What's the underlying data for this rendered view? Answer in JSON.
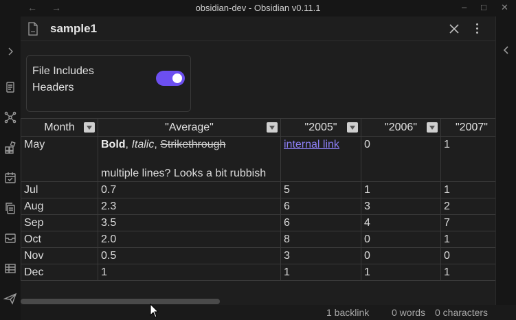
{
  "window": {
    "title": "obsidian-dev - Obsidian v0.11.1"
  },
  "file": {
    "title": "sample1"
  },
  "options": {
    "headers_label": "File Includes Headers",
    "headers_enabled": true
  },
  "table": {
    "columns": [
      "Month",
      "\"Average\"",
      "\"2005\"",
      "\"2006\"",
      "\"2007\""
    ],
    "first_row": {
      "month": "May",
      "avg_bold": "Bold",
      "avg_sep1": ", ",
      "avg_italic": "Italic",
      "avg_sep2": ", ",
      "avg_strike": "Strikethrough",
      "avg_second_line": "multiple lines? Looks a bit rubbish",
      "y2005_link": "internal link",
      "y2006": "0",
      "y2007": "1"
    },
    "rows": [
      {
        "month": "Jul",
        "avg": "0.7",
        "y2005": "5",
        "y2006": "1",
        "y2007": "1"
      },
      {
        "month": "Aug",
        "avg": "2.3",
        "y2005": "6",
        "y2006": "3",
        "y2007": "2"
      },
      {
        "month": "Sep",
        "avg": "3.5",
        "y2005": "6",
        "y2006": "4",
        "y2007": "7"
      },
      {
        "month": "Oct",
        "avg": "2.0",
        "y2005": "8",
        "y2006": "0",
        "y2007": "1"
      },
      {
        "month": "Nov",
        "avg": "0.5",
        "y2005": "3",
        "y2006": "0",
        "y2007": "0"
      },
      {
        "month": "Dec",
        "avg": "1",
        "y2005": "1",
        "y2006": "1",
        "y2007": "1"
      }
    ]
  },
  "status": {
    "backlinks": "1 backlink",
    "words": "0 words",
    "characters": "0 characters"
  },
  "colors": {
    "accent": "#6c4ff0",
    "link": "#8c7ff5",
    "background": "#1e1e1e"
  },
  "icons": {
    "ribbon": [
      "expand-sidebar-icon",
      "open-quick-switcher-icon",
      "graph-view-icon",
      "plugin-grid-icon",
      "calendar-icon",
      "copy-icon",
      "inbox-icon",
      "table-icon",
      "send-icon"
    ]
  }
}
